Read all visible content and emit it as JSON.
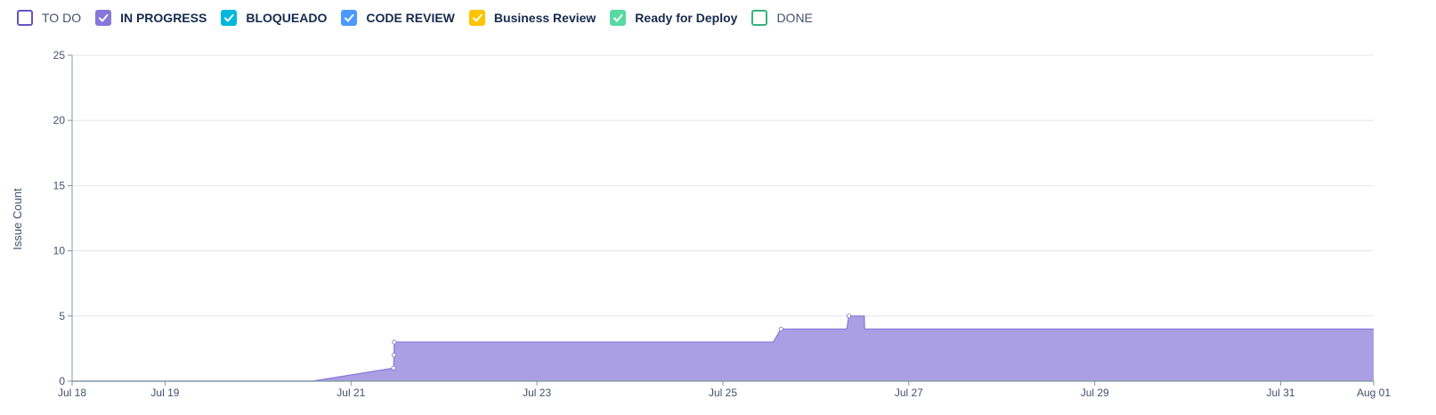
{
  "legend": [
    {
      "label": "TO DO",
      "color": "#6554c0",
      "checked": false,
      "bold": false
    },
    {
      "label": "IN PROGRESS",
      "color": "#8777d9",
      "checked": true,
      "bold": true
    },
    {
      "label": "BLOQUEADO",
      "color": "#00b8d9",
      "checked": true,
      "bold": true
    },
    {
      "label": "CODE REVIEW",
      "color": "#4c9aff",
      "checked": true,
      "bold": true
    },
    {
      "label": "Business Review",
      "color": "#ffc400",
      "checked": true,
      "bold": true
    },
    {
      "label": "Ready for Deploy",
      "color": "#57d9a3",
      "checked": true,
      "bold": true
    },
    {
      "label": "DONE",
      "color": "#36b37e",
      "checked": false,
      "bold": false
    }
  ],
  "chart_data": {
    "type": "area",
    "ylabel": "Issue Count",
    "ylim": [
      0,
      25
    ],
    "yticks": [
      0,
      5,
      10,
      15,
      20,
      25
    ],
    "xlim": [
      "2019-07-18",
      "2019-08-01"
    ],
    "xtick_labels": [
      "Jul 18",
      "Jul 19",
      "Jul 21",
      "Jul 23",
      "Jul 25",
      "Jul 27",
      "Jul 29",
      "Jul 31",
      "Aug 01"
    ],
    "xtick_dates": [
      "2019-07-18",
      "2019-07-19",
      "2019-07-21",
      "2019-07-23",
      "2019-07-25",
      "2019-07-27",
      "2019-07-29",
      "2019-07-31",
      "2019-08-01"
    ],
    "grid": true,
    "series": [
      {
        "name": "IN PROGRESS",
        "color": "#8777d9",
        "fill": "#aa9fe3",
        "points": [
          {
            "x": "2019-07-18 00:00",
            "y": 0
          },
          {
            "x": "2019-07-20 14:00",
            "y": 0
          },
          {
            "x": "2019-07-21 11:00",
            "y": 1
          },
          {
            "x": "2019-07-21 11:05",
            "y": 2
          },
          {
            "x": "2019-07-21 11:10",
            "y": 3
          },
          {
            "x": "2019-07-25 13:00",
            "y": 3
          },
          {
            "x": "2019-07-25 15:00",
            "y": 4
          },
          {
            "x": "2019-07-26 08:00",
            "y": 4
          },
          {
            "x": "2019-07-26 08:30",
            "y": 5
          },
          {
            "x": "2019-07-26 12:30",
            "y": 5
          },
          {
            "x": "2019-07-26 12:35",
            "y": 4
          },
          {
            "x": "2019-08-01 00:00",
            "y": 4
          }
        ],
        "markers": [
          {
            "x": "2019-07-21 11:00",
            "y": 1
          },
          {
            "x": "2019-07-21 11:05",
            "y": 2
          },
          {
            "x": "2019-07-21 11:10",
            "y": 3
          },
          {
            "x": "2019-07-25 15:00",
            "y": 4
          },
          {
            "x": "2019-07-26 08:30",
            "y": 5
          }
        ]
      },
      {
        "name": "DONE",
        "color": "#36b37e",
        "points": [
          {
            "x": "2019-07-18 00:00",
            "y": 0
          },
          {
            "x": "2019-08-01 00:00",
            "y": 0
          }
        ]
      }
    ]
  }
}
